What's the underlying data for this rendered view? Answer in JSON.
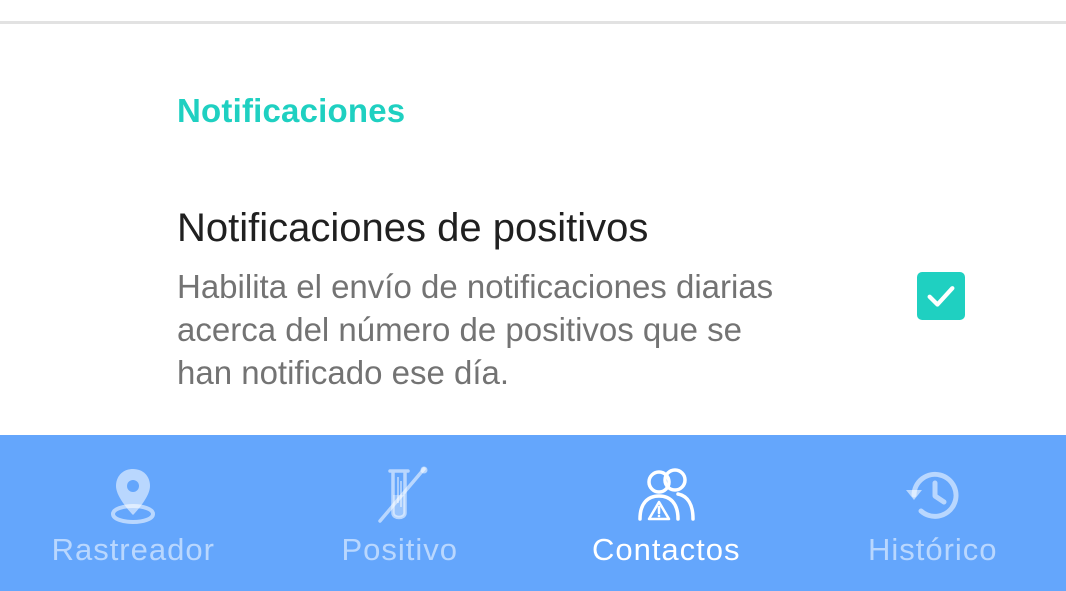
{
  "settings": {
    "section_title": "Notificaciones",
    "positive_notifications": {
      "title": "Notificaciones de positivos",
      "summary_lines": [
        "Habilita el envío de notificaciones diarias",
        "acerca del número de positivos que se",
        "han notificado ese día."
      ],
      "checked": true
    }
  },
  "bottom_nav": {
    "items": [
      {
        "label": "Rastreador",
        "icon": "location-pin-icon",
        "active": false
      },
      {
        "label": "Positivo",
        "icon": "test-tube-icon",
        "active": false
      },
      {
        "label": "Contactos",
        "icon": "contacts-warning-icon",
        "active": true
      },
      {
        "label": "Histórico",
        "icon": "history-icon",
        "active": false
      }
    ]
  },
  "colors": {
    "accent": "#1fd0c1",
    "nav_background": "#64a6fc",
    "nav_active": "#ffffff",
    "nav_inactive": "rgba(255,255,255,0.55)"
  }
}
